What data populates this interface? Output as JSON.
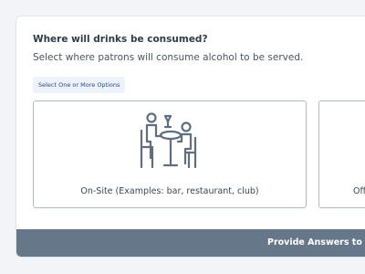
{
  "question": {
    "heading": "Where will drinks be consumed?",
    "description": "Select where patrons will consume alcohol to be served.",
    "hint": "Select One or More Options"
  },
  "options": [
    {
      "label": "On-Site (Examples: bar, restaurant, club)",
      "icon": "bar-patron-icon"
    },
    {
      "label": "Off",
      "icon": "unknown"
    }
  ],
  "footer": {
    "button_label": "Provide Answers to Co"
  },
  "colors": {
    "page_background": "#f3f4f7",
    "card_background": "#ffffff",
    "option_border": "#aeb9c4",
    "icon_stroke": "#5f6f80",
    "footer_background": "#67778a",
    "hint_background": "#eef2fb"
  }
}
